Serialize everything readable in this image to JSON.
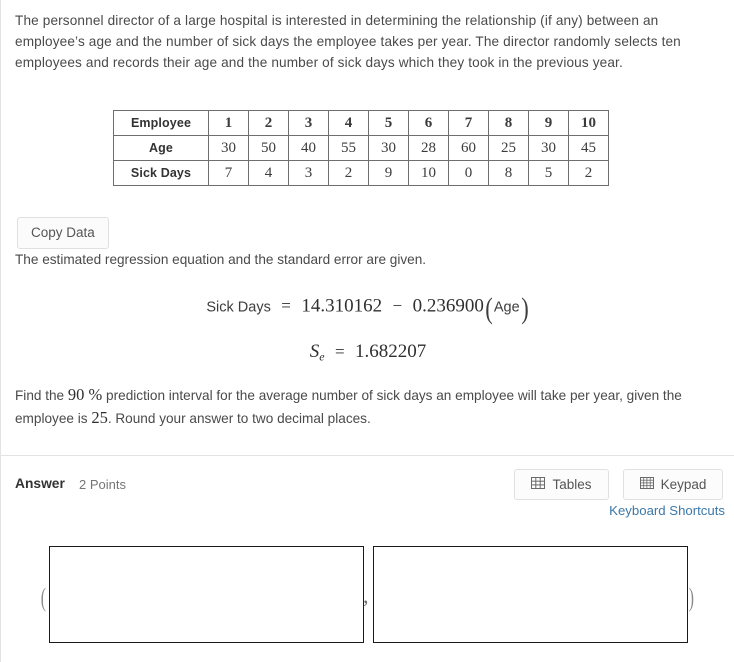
{
  "question": {
    "prompt": "The personnel director of a large hospital is interested in determining the relationship (if any) between an employee’s age and the number of sick days the employee takes per year. The director randomly selects ten employees and records their age and the number of sick days which they took in the previous year.",
    "regression_note": "The estimated regression equation and the standard error are given.",
    "find_prefix": "Find the ",
    "confidence_level": "90 %",
    "find_middle": " prediction interval for the average number of sick days an employee will take per year, given the employee is ",
    "given_age": "25",
    "find_suffix": ". Round your answer to two decimal places."
  },
  "copy_data_button": {
    "label": "Copy Data"
  },
  "chart_data": {
    "type": "table",
    "title": "",
    "row_headers": [
      "Employee",
      "Age",
      "Sick Days"
    ],
    "categories": [
      "1",
      "2",
      "3",
      "4",
      "5",
      "6",
      "7",
      "8",
      "9",
      "10"
    ],
    "series": [
      {
        "name": "Age",
        "values": [
          30,
          50,
          40,
          55,
          30,
          28,
          60,
          25,
          30,
          45
        ]
      },
      {
        "name": "Sick Days",
        "values": [
          7,
          4,
          3,
          2,
          9,
          10,
          0,
          8,
          5,
          2
        ]
      }
    ],
    "xlabel": "Employee",
    "ylabel": ""
  },
  "equation": {
    "lhs": "Sick Days",
    "equals": "=",
    "intercept": "14.310162",
    "operator": "−",
    "slope": "0.236900",
    "variable": "Age",
    "open_paren": "(",
    "close_paren": ")"
  },
  "standard_error": {
    "symbol": "S",
    "subscript": "e",
    "equals": "=",
    "value": "1.682207"
  },
  "answer_section": {
    "label": "Answer",
    "points": "2 Points",
    "tables_button": "Tables",
    "keypad_button": "Keypad",
    "keyboard_shortcuts": "Keyboard Shortcuts",
    "open_paren": "(",
    "comma": ",",
    "close_paren": ")",
    "lower_bound_value": "",
    "upper_bound_value": "",
    "lower_bound_placeholder": "",
    "upper_bound_placeholder": ""
  },
  "colors": {
    "link": "#3c78a8",
    "text": "#4a4a4a",
    "border": "#e3e3e3",
    "input_border": "#1a1a1a"
  }
}
